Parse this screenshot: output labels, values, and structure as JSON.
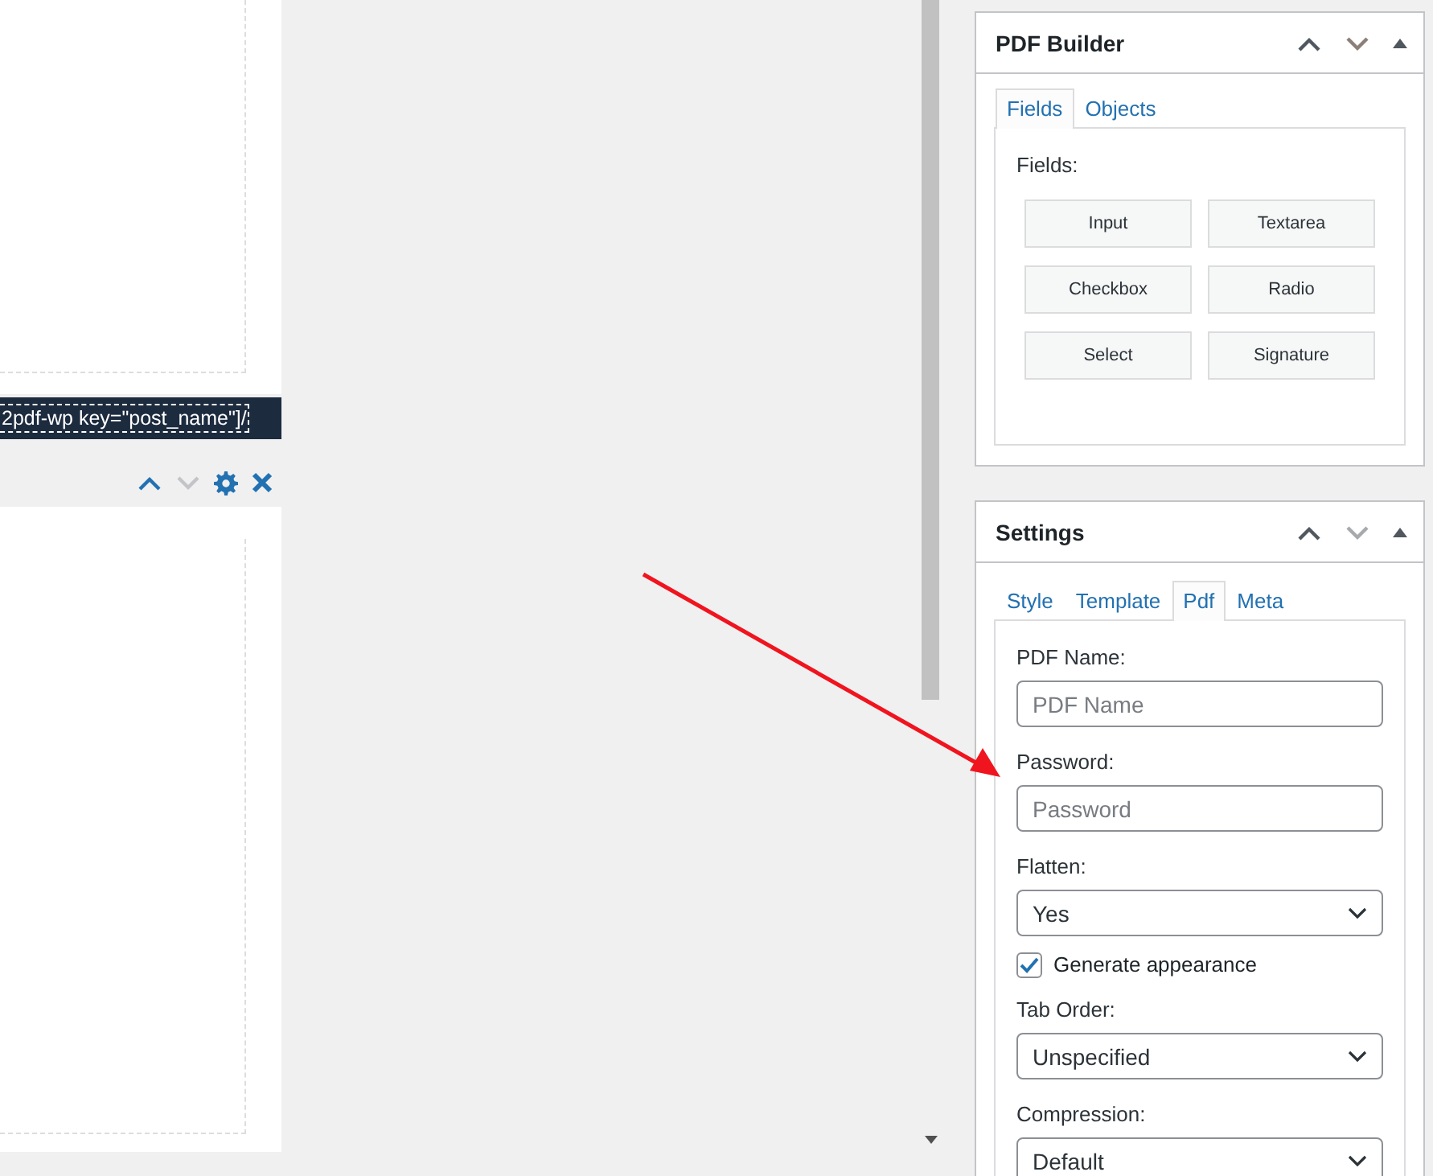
{
  "editor": {
    "shortcode": "2pdf-wp key=\"post_name\"]/"
  },
  "builder": {
    "title": "PDF Builder",
    "tabs": [
      {
        "label": "Fields",
        "selected": true
      },
      {
        "label": "Objects",
        "selected": false
      }
    ],
    "heading": "Fields:",
    "buttons": [
      "Input",
      "Textarea",
      "Checkbox",
      "Radio",
      "Select",
      "Signature"
    ]
  },
  "settings": {
    "title": "Settings",
    "tabs": [
      {
        "label": "Style",
        "selected": false
      },
      {
        "label": "Template",
        "selected": false
      },
      {
        "label": "Pdf",
        "selected": true
      },
      {
        "label": "Meta",
        "selected": false
      }
    ],
    "fields": [
      {
        "kind": "text",
        "label": "PDF Name:",
        "placeholder": "PDF Name"
      },
      {
        "kind": "text",
        "label": "Password:",
        "placeholder": "Password"
      },
      {
        "kind": "select",
        "label": "Flatten:",
        "value": "Yes"
      },
      {
        "kind": "checkbox",
        "label": "Generate appearance",
        "checked": true
      },
      {
        "kind": "select",
        "label": "Tab Order:",
        "value": "Unspecified"
      },
      {
        "kind": "select",
        "label": "Compression:",
        "value": "Default"
      }
    ]
  }
}
